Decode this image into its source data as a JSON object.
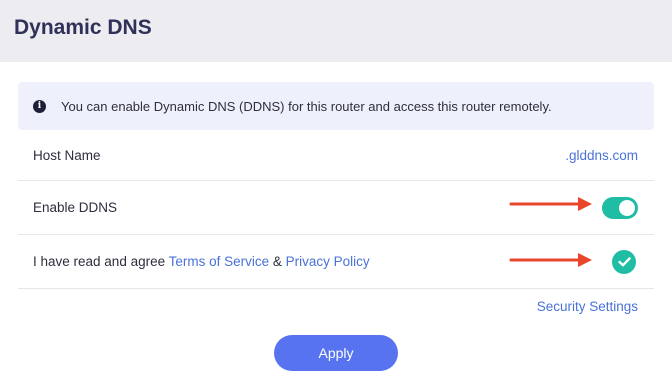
{
  "header": {
    "title": "Dynamic DNS"
  },
  "info": {
    "icon": "info-icon",
    "text": "You can enable Dynamic DNS (DDNS) for this router and access this router remotely."
  },
  "host_name": {
    "label": "Host Name",
    "value": ".glddns.com"
  },
  "enable_ddns": {
    "label": "Enable DDNS",
    "enabled": true
  },
  "agreement": {
    "prefix": "I have read and agree ",
    "terms_link": "Terms of Service",
    "separator": " & ",
    "privacy_link": "Privacy Policy",
    "checked": true
  },
  "security_settings_link": "Security Settings",
  "apply_button": "Apply",
  "colors": {
    "accent_teal": "#1fbea4",
    "link_blue": "#4a72d8",
    "button_blue": "#5873f0",
    "annotation_red": "#e8462c"
  }
}
